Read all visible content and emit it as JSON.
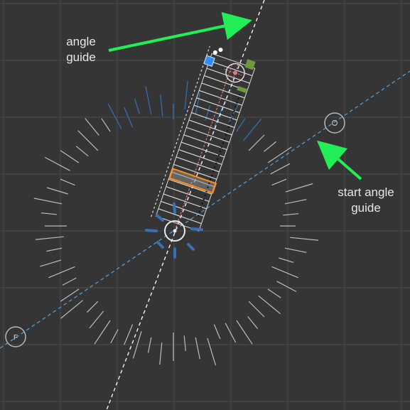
{
  "annotations": {
    "angle_guide": "angle\nguide",
    "start_angle_guide": "start angle\nguide"
  },
  "markers": {
    "start_marker_letter": "F"
  },
  "colors": {
    "background": "#353535",
    "grid": "#4a4a4a",
    "arrow": "#22ee55",
    "start_guide": "#4f9bd6",
    "angle_guide": "#f2f2f2",
    "selection": "#ff8c1a",
    "handle_blue": "#2f8fff",
    "handle_green": "#6f9a3c",
    "gizmo_blue": "#3a6fb8",
    "center_line": "#e07a7a"
  },
  "icons": {
    "pivot": "pivot-circle-icon",
    "target": "target-crosshair-icon",
    "start_marker": "start-marker-icon"
  }
}
